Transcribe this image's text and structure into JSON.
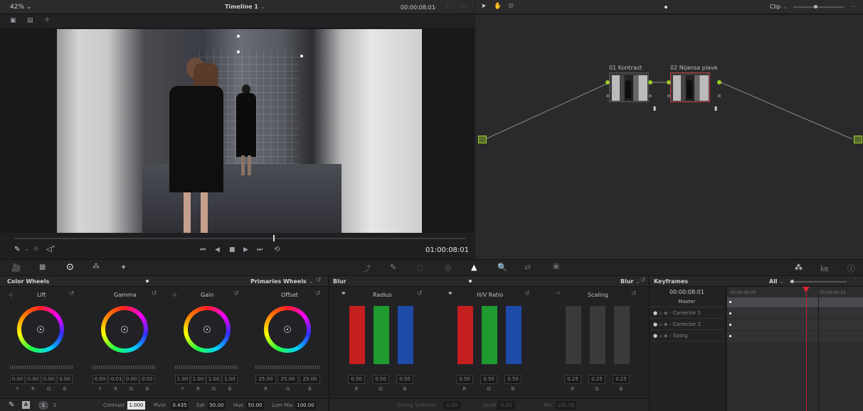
{
  "viewer": {
    "zoom": "42%",
    "title": "Timeline 1",
    "timecode_top": "00:00:08:01",
    "timecode": "01:00:08:01"
  },
  "node_editor": {
    "mode": "Clip",
    "nodes": [
      {
        "label": "01 Kontrast"
      },
      {
        "label": "02 Nijansa plave"
      }
    ]
  },
  "color_wheels": {
    "title": "Color Wheels",
    "mode": "Primaries Wheels",
    "wheels": [
      {
        "name": "Lift",
        "values": [
          "0.00",
          "0.00",
          "0.00",
          "0.00"
        ]
      },
      {
        "name": "Gamma",
        "values": [
          "0.00",
          "-0.01",
          "0.00",
          "0.02"
        ]
      },
      {
        "name": "Gain",
        "values": [
          "1.00",
          "1.00",
          "1.00",
          "1.00"
        ]
      },
      {
        "name": "Offset",
        "values": [
          "25.00",
          "25.00",
          "25.00"
        ]
      }
    ],
    "channels4": [
      "Y",
      "R",
      "G",
      "B"
    ],
    "channels3": [
      "R",
      "G",
      "B"
    ],
    "footer": {
      "page1": "1",
      "page2": "2",
      "contrast_label": "Contrast",
      "contrast": "1.000",
      "pivot_label": "Pivot",
      "pivot": "0.435",
      "sat_label": "Sat",
      "sat": "50.00",
      "hue_label": "Hue",
      "hue": "50.00",
      "lummix_label": "Lum Mix",
      "lummix": "100.00"
    }
  },
  "blur": {
    "title": "Blur",
    "mode": "Blur",
    "groups": [
      {
        "name": "Radius",
        "values": [
          "0.50",
          "0.50",
          "0.50"
        ]
      },
      {
        "name": "H/V Ratio",
        "values": [
          "0.50",
          "0.50",
          "0.50"
        ]
      },
      {
        "name": "Scaling",
        "values": [
          "0.25",
          "0.25",
          "0.25"
        ]
      }
    ],
    "channels": [
      "R",
      "G",
      "B"
    ],
    "footer": {
      "coring_label": "Coring Softness",
      "coring": "0.00",
      "level_label": "Level",
      "level": "0.00",
      "mix_label": "Mix",
      "mix": "100.00"
    }
  },
  "keyframes": {
    "title": "Keyframes",
    "filter": "All",
    "timecode": "00:00:08:01",
    "ruler_start": "00:00:00:00",
    "ruler_end": "00:00:09:13",
    "tracks": [
      "Master",
      "Corrector 1",
      "Corrector 2",
      "Sizing"
    ]
  },
  "colors": {
    "accent": "#9ccc2a",
    "playhead": "#e0282e",
    "panel": "#28282b"
  }
}
